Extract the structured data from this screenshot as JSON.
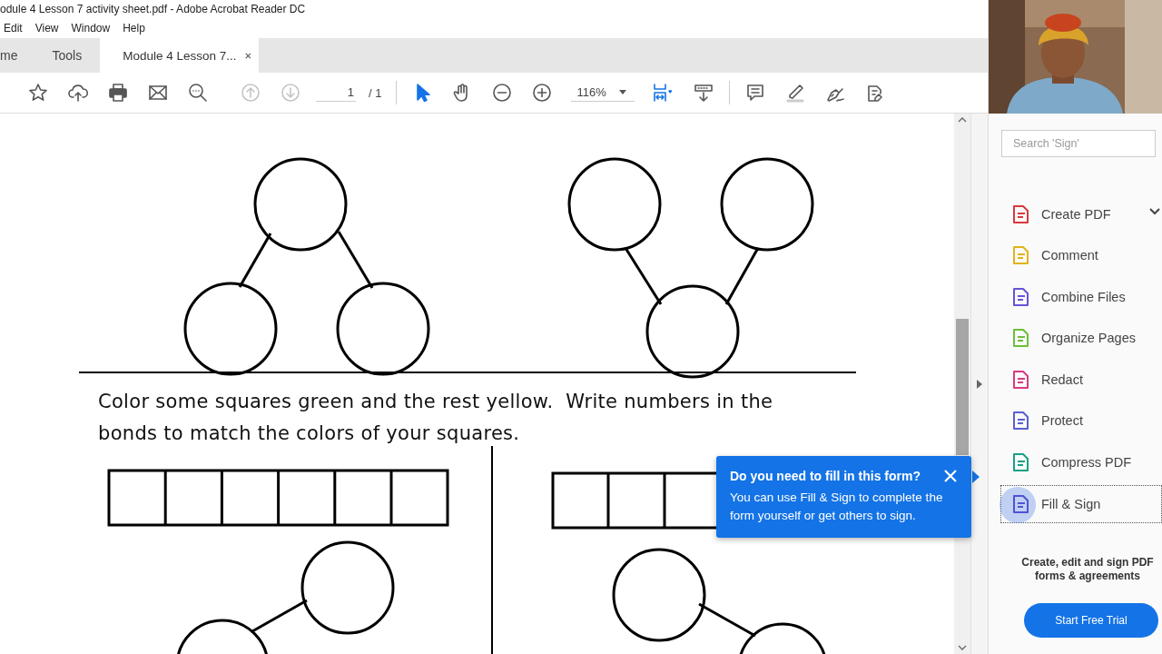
{
  "window": {
    "title": "odule 4 Lesson 7 activity sheet.pdf - Adobe Acrobat Reader DC"
  },
  "menu": [
    "Edit",
    "View",
    "Window",
    "Help"
  ],
  "tabs": [
    {
      "label": "me",
      "selected": false,
      "closable": false
    },
    {
      "label": "Tools",
      "selected": false,
      "closable": false
    },
    {
      "label": "Module 4 Lesson 7...",
      "selected": true,
      "closable": true
    }
  ],
  "toolbar": {
    "buttons": [
      {
        "kind": "star"
      },
      {
        "kind": "upload"
      },
      {
        "kind": "print"
      },
      {
        "kind": "mail"
      },
      {
        "kind": "find"
      },
      {
        "kind": "gap"
      },
      {
        "kind": "page-up",
        "disabled": true
      },
      {
        "kind": "page-down",
        "disabled": true
      },
      {
        "kind": "page"
      },
      {
        "kind": "divider"
      },
      {
        "kind": "select",
        "selected": true
      },
      {
        "kind": "hand",
        "selected": false
      },
      {
        "kind": "zoom-out"
      },
      {
        "kind": "zoom-in"
      },
      {
        "kind": "zoom"
      },
      {
        "kind": "fit"
      },
      {
        "kind": "scroll"
      },
      {
        "kind": "divider"
      },
      {
        "kind": "comment"
      },
      {
        "kind": "highlight"
      },
      {
        "kind": "sign"
      },
      {
        "kind": "edit"
      }
    ],
    "page_current": "1",
    "page_total": "/ 1",
    "zoom": "116%"
  },
  "document": {
    "instruction": "Color some squares green and the rest yellow.  Write numbers in the bonds to match the colors of your squares."
  },
  "popup": {
    "title": "Do you need to fill in this form?",
    "body": "You can use Fill & Sign to complete the form yourself or get others to sign."
  },
  "sidebar": {
    "search": {
      "placeholder": "Search 'Sign'"
    },
    "tools": [
      {
        "name": "Create PDF",
        "color": "#d8373e",
        "expandable": true,
        "selected": false
      },
      {
        "name": "Comment",
        "color": "#e3b316",
        "expandable": false,
        "selected": false
      },
      {
        "name": "Combine Files",
        "color": "#6554d8",
        "expandable": false,
        "selected": false
      },
      {
        "name": "Organize Pages",
        "color": "#6bbf3b",
        "expandable": false,
        "selected": false
      },
      {
        "name": "Redact",
        "color": "#d93a7f",
        "expandable": false,
        "selected": false
      },
      {
        "name": "Protect",
        "color": "#5a5fd1",
        "expandable": false,
        "selected": false
      },
      {
        "name": "Compress PDF",
        "color": "#16a085",
        "expandable": false,
        "selected": false
      },
      {
        "name": "Fill & Sign",
        "color": "#5151d3",
        "expandable": false,
        "selected": true
      }
    ],
    "promo": "Create, edit and sign PDF forms & agreements",
    "trial_button": "Start Free Trial"
  }
}
